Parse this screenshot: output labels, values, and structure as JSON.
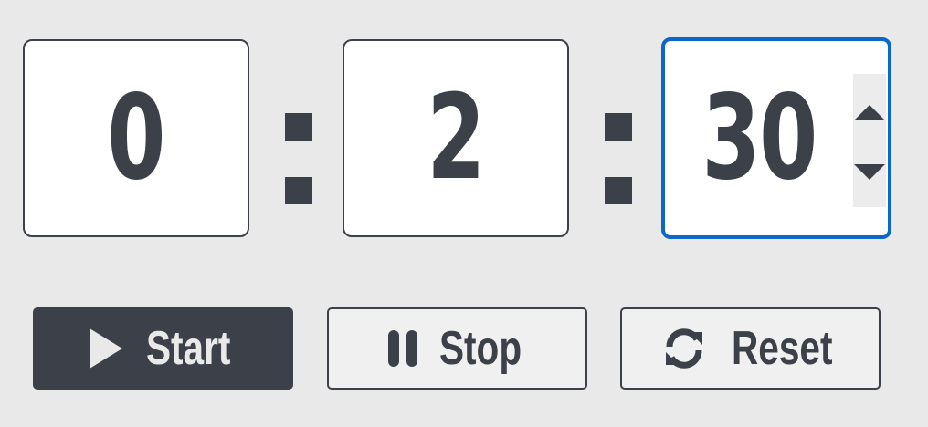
{
  "timer": {
    "hours": "0",
    "minutes": "2",
    "seconds": "30",
    "separator": ":"
  },
  "buttons": {
    "start": {
      "label": "Start",
      "icon": "play-icon"
    },
    "stop": {
      "label": "Stop",
      "icon": "pause-icon"
    },
    "reset": {
      "label": "Reset",
      "icon": "refresh-icon"
    }
  },
  "colors": {
    "background": "#e9e9e9",
    "text": "#3c4049",
    "focus_border": "#0b67c8"
  }
}
